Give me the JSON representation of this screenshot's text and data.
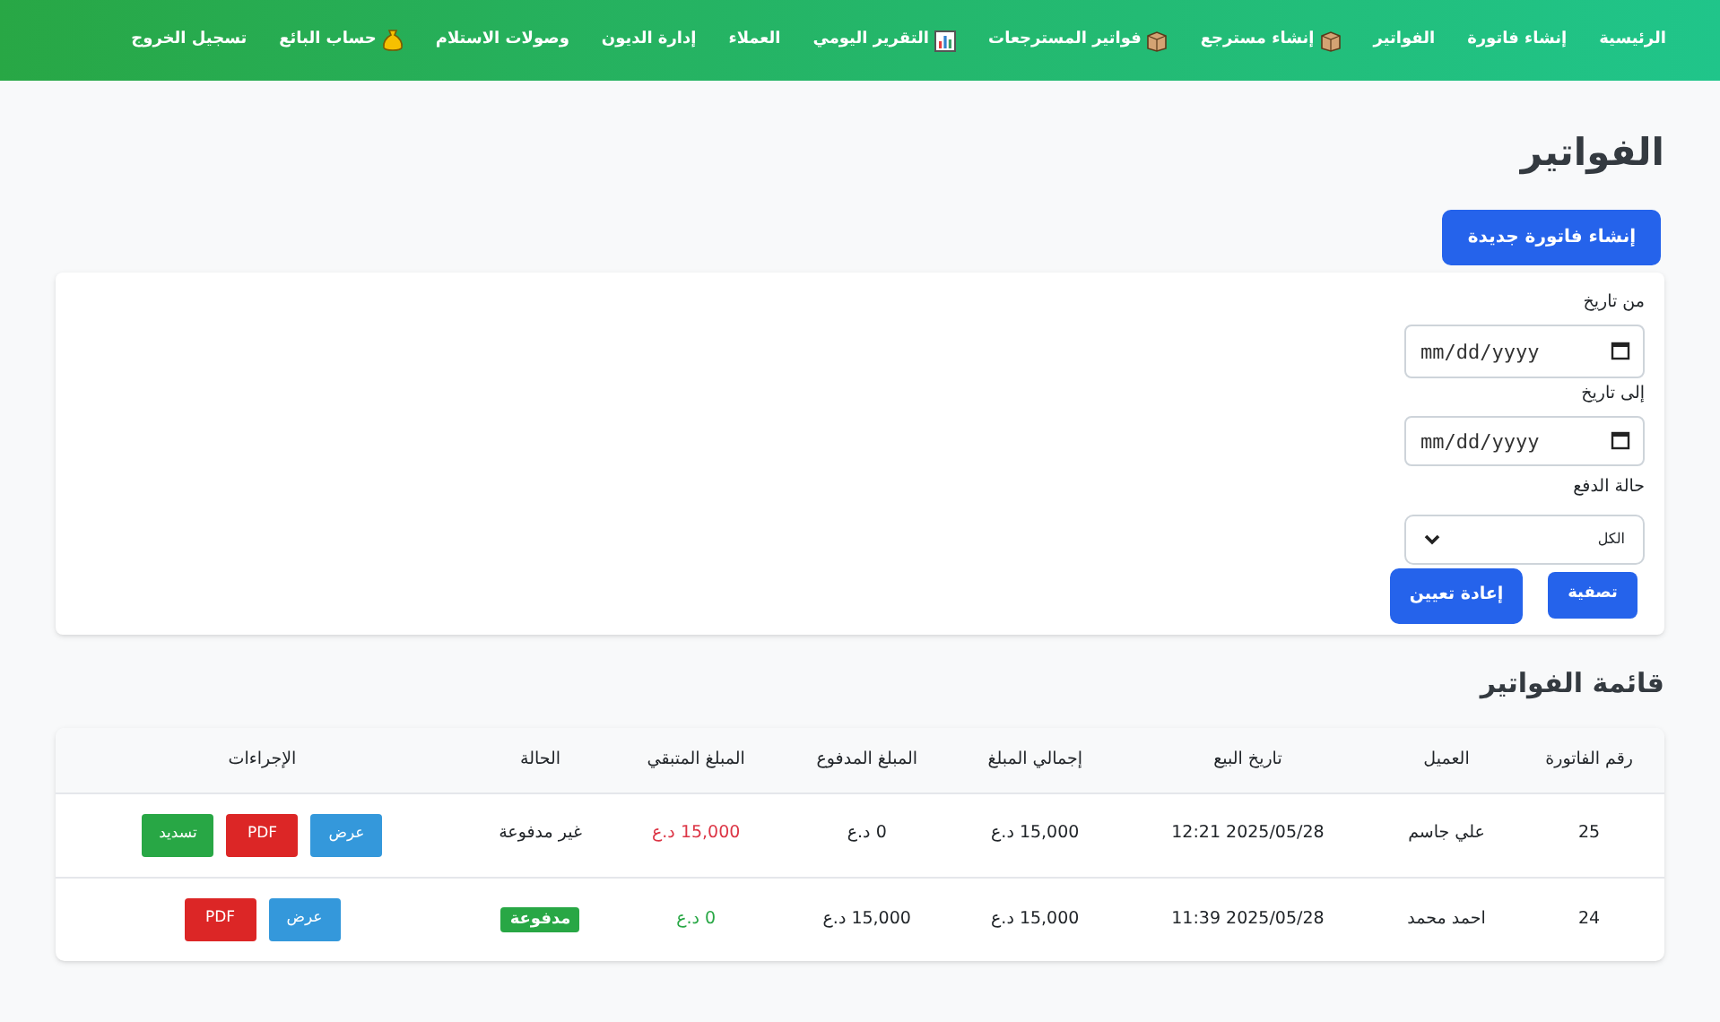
{
  "nav": [
    {
      "label": "الرئيسية"
    },
    {
      "label": "إنشاء فاتورة"
    },
    {
      "label": "الفواتير"
    },
    {
      "label": "إنشاء مسترجع",
      "kind": "box"
    },
    {
      "label": "فواتير المسترجعات",
      "kind": "box"
    },
    {
      "label": "التقرير اليومي",
      "kind": "chart"
    },
    {
      "label": "العملاء"
    },
    {
      "label": "إدارة الديون"
    },
    {
      "label": "وصولات الاستلام"
    },
    {
      "label": "حساب البائع",
      "kind": "moneybag"
    },
    {
      "label": "تسجيل الخروج"
    }
  ],
  "page_title": "الفواتير",
  "new_button": "إنشاء فاتورة جديدة",
  "filters": {
    "from_label": "من تاريخ",
    "from_placeholder": "mm/dd/yyyy",
    "to_label": "إلى تاريخ",
    "to_placeholder": "mm/dd/yyyy",
    "status_label": "حالة الدفع",
    "status_value": "الكل",
    "filter_button": "تصفية",
    "reset_button": "إعادة تعيين"
  },
  "list_title": "قائمة الفواتير",
  "table": {
    "columns": [
      "رقم الفاتورة",
      "العميل",
      "تاريخ البيع",
      "إجمالي المبلغ",
      "المبلغ المدفوع",
      "المبلغ المتبقي",
      "الحالة",
      "الإجراءات"
    ],
    "rows": [
      {
        "number": "25",
        "customer": "علي جاسم",
        "date": "2025/05/28 12:21",
        "total": "15,000 د.ع",
        "paid": "0 د.ع",
        "remaining": "15,000 د.ع",
        "status": "غير مدفوعة",
        "kind": "unpaid",
        "actions": [
          {
            "label": "عرض",
            "kind": "view"
          },
          {
            "label": "PDF",
            "kind": "pdf"
          },
          {
            "label": "تسديد",
            "kind": "pay"
          }
        ]
      },
      {
        "number": "24",
        "customer": "احمد محمد",
        "date": "2025/05/28 11:39",
        "total": "15,000 د.ع",
        "paid": "15,000 د.ع",
        "remaining": "0 د.ع",
        "status": "مدفوعة",
        "kind": "paid",
        "actions": [
          {
            "label": "عرض",
            "kind": "view"
          },
          {
            "label": "PDF",
            "kind": "pdf"
          }
        ]
      }
    ]
  }
}
